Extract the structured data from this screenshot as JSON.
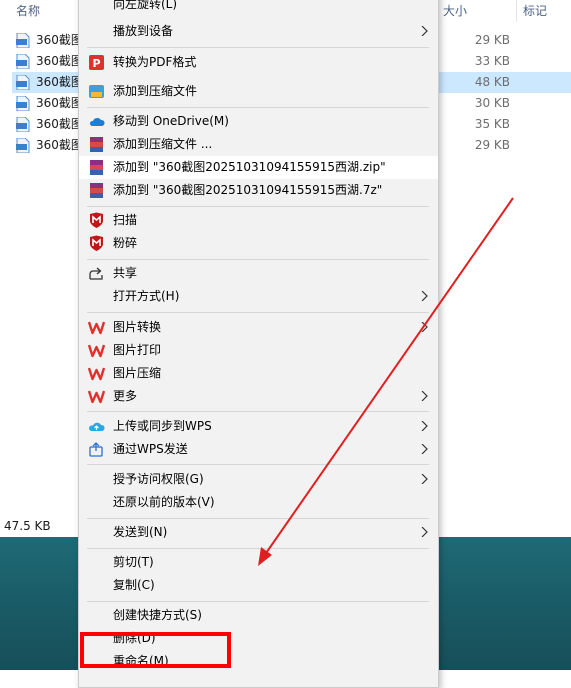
{
  "explorer": {
    "columns": {
      "name": "名称",
      "size": "大小",
      "tags": "标记"
    },
    "files": [
      {
        "name": "360截图",
        "size": "29 KB",
        "selected": false
      },
      {
        "name": "360截图",
        "size": "33 KB",
        "selected": false
      },
      {
        "name": "360截图",
        "size": "48 KB",
        "selected": true
      },
      {
        "name": "360截图",
        "size": "30 KB",
        "selected": false
      },
      {
        "name": "360截图",
        "size": "35 KB",
        "selected": false
      },
      {
        "name": "360截图",
        "size": "29 KB",
        "selected": false
      }
    ],
    "status": "47.5 KB"
  },
  "menu": {
    "rotate_left": "向左旋转(L)",
    "cast_to_device": "播放到设备",
    "convert_pdf": "转换为PDF格式",
    "add_archive": "添加到压缩文件",
    "move_onedrive": "移动到 OneDrive(M)",
    "add_archive_more": "添加到压缩文件 ...",
    "add_zip": "添加到 \"360截图20251031094155915西湖.zip\"",
    "add_7z": "添加到 \"360截图20251031094155915西湖.7z\"",
    "scan": "扫描",
    "shred": "粉碎",
    "share": "共享",
    "open_with": "打开方式(H)",
    "image_convert": "图片转换",
    "image_print": "图片打印",
    "image_compress": "图片压缩",
    "more": "更多",
    "upload_wps": "上传或同步到WPS",
    "send_wps": "通过WPS发送",
    "grant_access": "授予访问权限(G)",
    "restore_versions": "还原以前的版本(V)",
    "send_to": "发送到(N)",
    "cut": "剪切(T)",
    "copy": "复制(C)",
    "create_shortcut": "创建快捷方式(S)",
    "delete": "删除(D)",
    "rename": "重命名(M)"
  },
  "colors": {
    "accent_red": "#ff0000",
    "selection": "#cce8ff",
    "wps_red": "#e0322c",
    "mcafee_red": "#c01818",
    "onedrive_blue": "#1e7fd8"
  }
}
